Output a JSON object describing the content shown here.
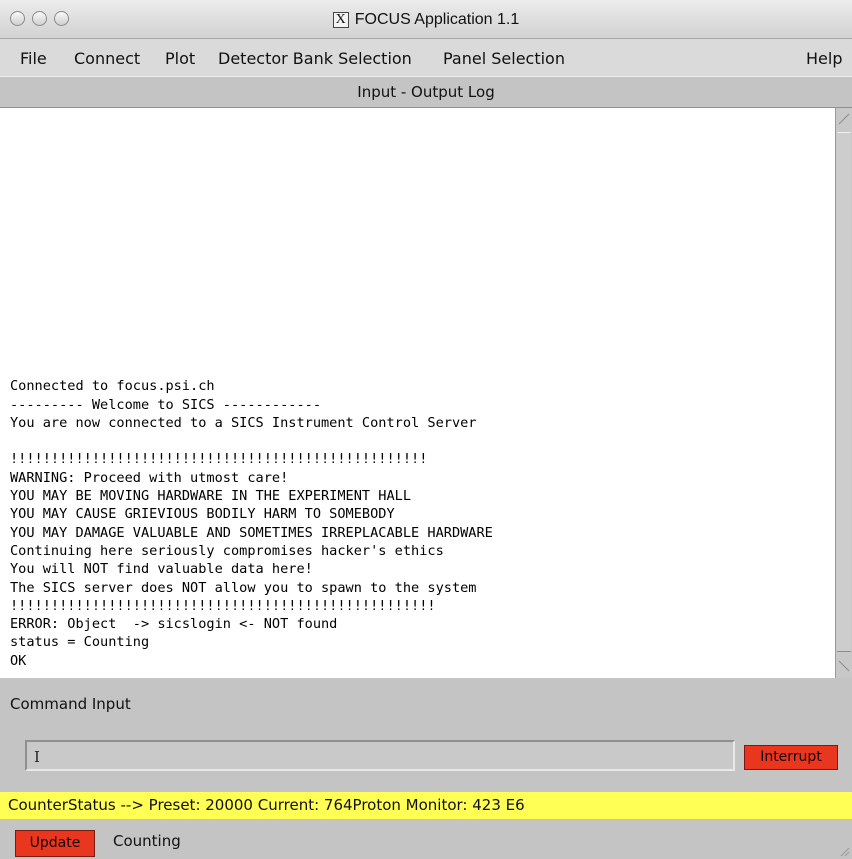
{
  "window": {
    "title": "FOCUS Application 1.1",
    "x_logo_glyph": "X"
  },
  "menubar": {
    "items": [
      "File",
      "Connect",
      "Plot",
      "Detector Bank Selection",
      "Panel Selection"
    ],
    "help": "Help"
  },
  "log": {
    "header": "Input - Output Log",
    "lines": [
      "Connected to focus.psi.ch",
      "--------- Welcome to SICS ------------",
      "You are now connected to a SICS Instrument Control Server",
      "",
      "!!!!!!!!!!!!!!!!!!!!!!!!!!!!!!!!!!!!!!!!!!!!!!!!!!!",
      "WARNING: Proceed with utmost care!",
      "YOU MAY BE MOVING HARDWARE IN THE EXPERIMENT HALL",
      "YOU MAY CAUSE GRIEVIOUS BODILY HARM TO SOMEBODY",
      "YOU MAY DAMAGE VALUABLE AND SOMETIMES IRREPLACABLE HARDWARE",
      "Continuing here seriously compromises hacker's ethics",
      "You will NOT find valuable data here!",
      "The SICS server does NOT allow you to spawn to the system",
      "!!!!!!!!!!!!!!!!!!!!!!!!!!!!!!!!!!!!!!!!!!!!!!!!!!!!",
      "ERROR: Object  -> sicslogin <- NOT found",
      "status = Counting",
      "OK"
    ]
  },
  "command": {
    "label": "Command Input",
    "value": "",
    "interrupt_label": "Interrupt"
  },
  "status_bar": {
    "text": "CounterStatus --> Preset: 20000 Current: 764Proton Monitor: 423 E6"
  },
  "footer": {
    "update_label": "Update",
    "state": "Counting"
  },
  "colors": {
    "button_red": "#e8361f",
    "status_yellow": "#ffff55",
    "panel_gray": "#c4c4c4"
  }
}
